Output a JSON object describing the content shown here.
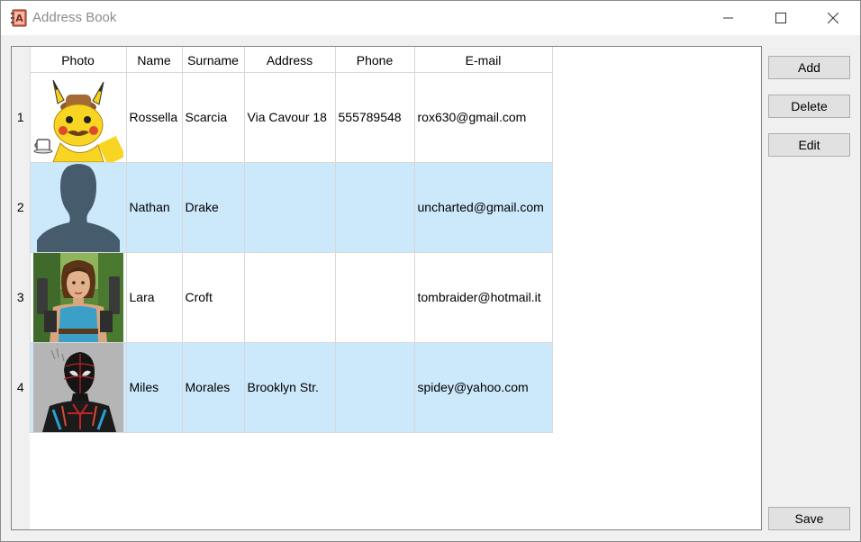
{
  "window": {
    "title": "Address Book"
  },
  "table": {
    "headers": [
      "Photo",
      "Name",
      "Surname",
      "Address",
      "Phone",
      "E-mail"
    ],
    "rows": [
      {
        "num": "1",
        "photo": "pikachu-detective-avatar",
        "name": "Rossella",
        "surname": "Scarcia",
        "address": "Via Cavour 18",
        "phone": "555789548",
        "email": "rox630@gmail.com"
      },
      {
        "num": "2",
        "photo": "default-silhouette-avatar",
        "name": "Nathan",
        "surname": "Drake",
        "address": "",
        "phone": "",
        "email": "uncharted@gmail.com"
      },
      {
        "num": "3",
        "photo": "lara-croft-avatar",
        "name": "Lara",
        "surname": "Croft",
        "address": "",
        "phone": "",
        "email": "tombraider@hotmail.it"
      },
      {
        "num": "4",
        "photo": "miles-morales-avatar",
        "name": "Miles",
        "surname": "Morales",
        "address": "Brooklyn Str.",
        "phone": "",
        "email": "spidey@yahoo.com"
      }
    ]
  },
  "buttons": {
    "add": "Add",
    "delete": "Delete",
    "edit": "Edit",
    "save": "Save"
  },
  "colors": {
    "selected_row": "#cce8fb",
    "title_text": "#8c8c8c"
  }
}
